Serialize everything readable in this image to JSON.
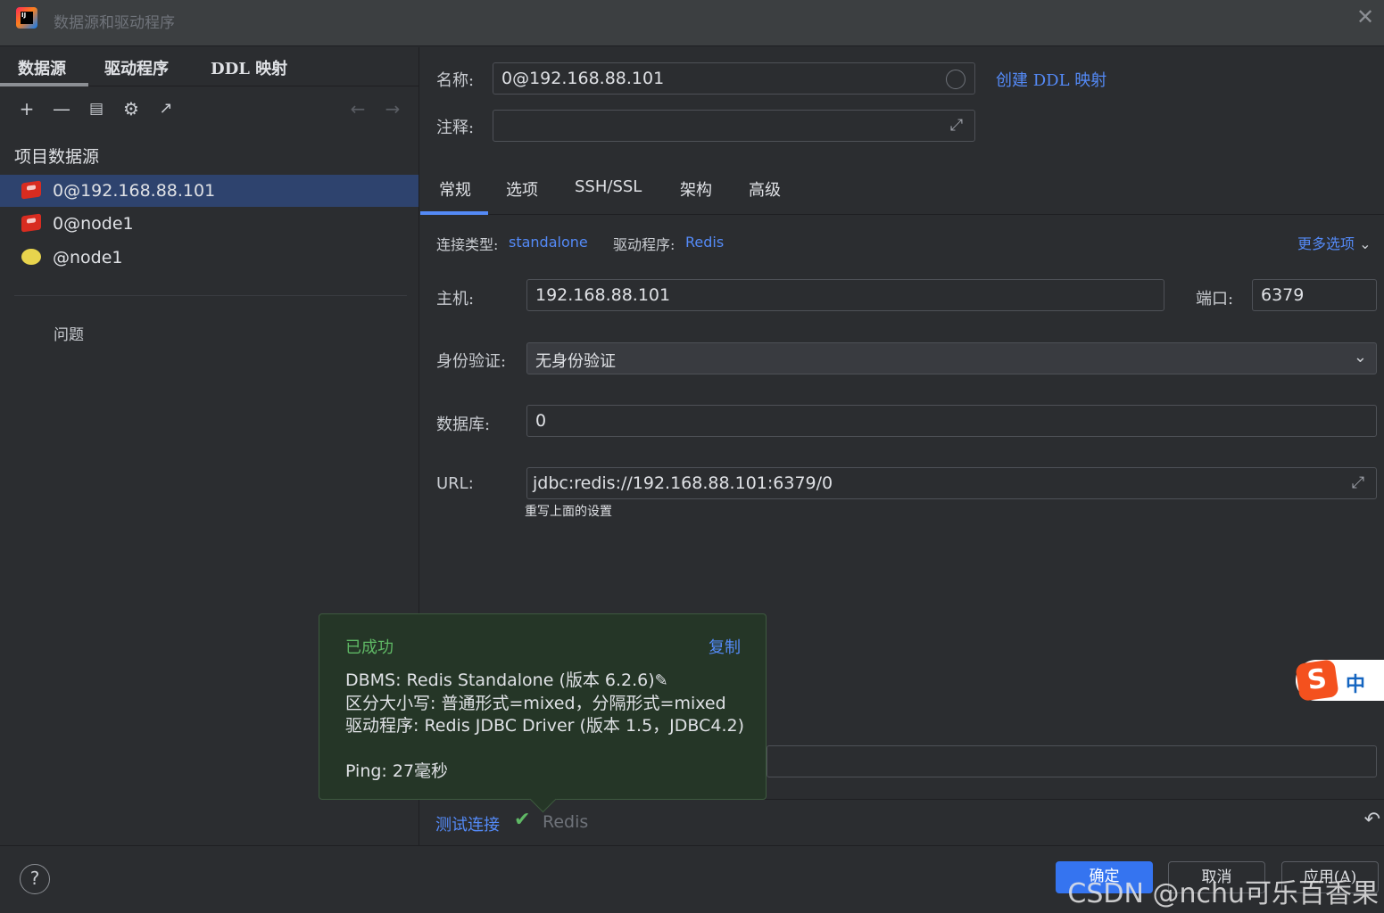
{
  "window": {
    "title": "数据源和驱动程序",
    "app_icon_text": "IJ"
  },
  "left": {
    "tabs": [
      "数据源",
      "驱动程序",
      "DDL 映射"
    ],
    "section_title": "项目数据源",
    "items": [
      {
        "label": "0@192.168.88.101",
        "icon": "redis-icon",
        "selected": true
      },
      {
        "label": "0@node1",
        "icon": "redis-icon",
        "selected": false
      },
      {
        "label": "@node1",
        "icon": "keydb-icon",
        "selected": false
      }
    ],
    "problems_label": "问题"
  },
  "form": {
    "name_label": "名称:",
    "name_value": "0@192.168.88.101",
    "create_ddl_link": "创建 DDL 映射",
    "comment_label": "注释:",
    "comment_value": "",
    "tabs": [
      "常规",
      "选项",
      "SSH/SSL",
      "架构",
      "高级"
    ],
    "conn_type_label": "连接类型:",
    "conn_type_value": "standalone",
    "driver_label": "驱动程序:",
    "driver_value": "Redis",
    "more_options": "更多选项",
    "host_label": "主机:",
    "host_value": "192.168.88.101",
    "port_label": "端口:",
    "port_value": "6379",
    "auth_label": "身份验证:",
    "auth_value": "无身份验证",
    "db_label": "数据库:",
    "db_value": "0",
    "url_label": "URL:",
    "url_value": "jdbc:redis://192.168.88.101:6379/0",
    "url_hint": "重写上面的设置"
  },
  "popup": {
    "status": "已成功",
    "copy": "复制",
    "line1": "DBMS: Redis Standalone (版本 6.2.6)",
    "line2": "区分大小写: 普通形式=mixed，分隔形式=mixed",
    "line3": "驱动程序: Redis JDBC Driver (版本 1.5，JDBC4.2)",
    "line4": "Ping: 27毫秒"
  },
  "bottom": {
    "test_connection": "测试连接",
    "driver_name": "Redis"
  },
  "footer": {
    "help": "?",
    "ok": "确定",
    "cancel": "取消",
    "apply": "应用(A)",
    "watermark": "CSDN @nchu可乐百香果"
  },
  "ime": {
    "logo": "S",
    "mode": "中"
  },
  "colors": {
    "accent": "#548af7",
    "success": "#5fb865",
    "selection": "#2e436e",
    "primary_button": "#3574f0"
  }
}
